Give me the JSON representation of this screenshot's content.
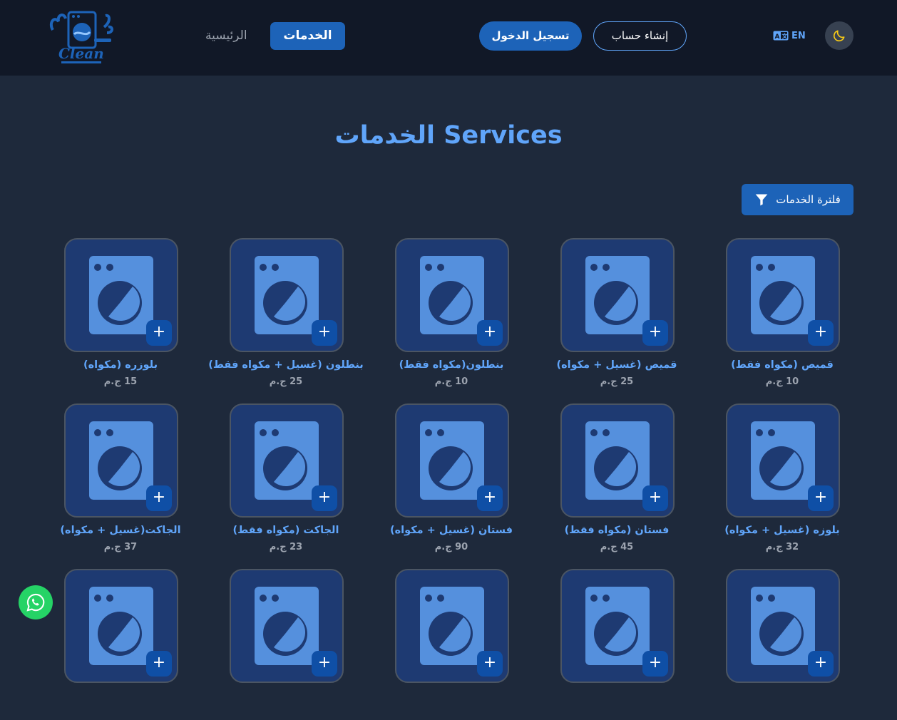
{
  "header": {
    "logo_text": "Clean",
    "nav": {
      "home": "الرئيسية",
      "services": "الخدمات"
    },
    "login_label": "تسجيل الدخول",
    "register_label": "إنشاء حساب",
    "lang_label": "EN"
  },
  "page": {
    "title": "الخدمات Services",
    "filter_label": "فلترة الخدمات"
  },
  "services": [
    {
      "name": "قميص (مكواه فقط)",
      "price": "10 ج.م"
    },
    {
      "name": "قميص (غسيل + مكواه)",
      "price": "25 ج.م"
    },
    {
      "name": "بنطلون(مكواه فقط)",
      "price": "10 ج.م"
    },
    {
      "name": "بنطلون (غسيل + مكواه فقط)",
      "price": "25 ج.م"
    },
    {
      "name": "بلوزره (مكواه)",
      "price": "15 ج.م"
    },
    {
      "name": "بلوزه (غسيل + مكواه)",
      "price": "32 ج.م"
    },
    {
      "name": "فستان (مكواه فقط)",
      "price": "45 ج.م"
    },
    {
      "name": "فستان (غسيل + مكواه)",
      "price": "90 ج.م"
    },
    {
      "name": "الجاكت (مكواه فقط)",
      "price": "23 ج.م"
    },
    {
      "name": "الجاكت(غسيل + مكواه)",
      "price": "37 ج.م"
    },
    {
      "name": "",
      "price": ""
    },
    {
      "name": "",
      "price": ""
    },
    {
      "name": "",
      "price": ""
    },
    {
      "name": "",
      "price": ""
    },
    {
      "name": "",
      "price": ""
    }
  ],
  "colors": {
    "accent": "#1d63b8",
    "accent_light": "#60a5fa",
    "header_bg": "#111827",
    "page_bg": "#1e293b",
    "card_bg": "#1e3a72",
    "whatsapp": "#25d366"
  }
}
